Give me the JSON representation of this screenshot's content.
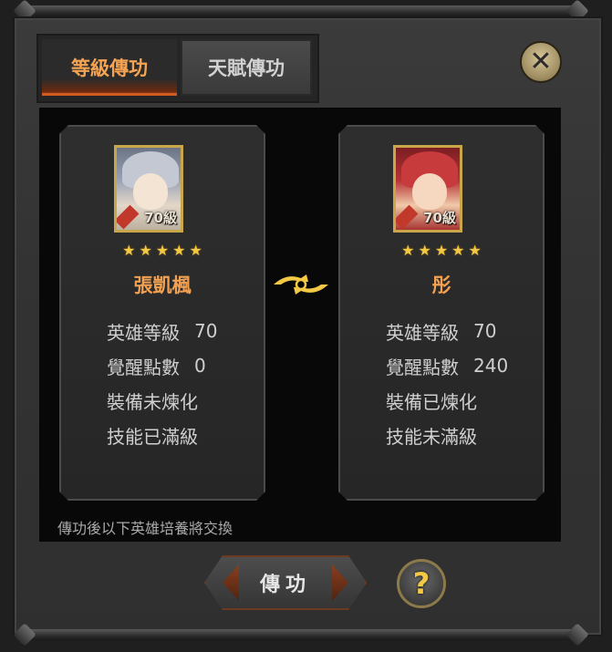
{
  "tabs": [
    {
      "label": "等級傳功",
      "active": true
    },
    {
      "label": "天賦傳功",
      "active": false
    }
  ],
  "close": {
    "icon": "close-icon",
    "glyph": "✕"
  },
  "heroes": {
    "source": {
      "name": "張凱楓",
      "level_badge": "70級",
      "stars": [
        "★",
        "★",
        "★",
        "★",
        "★"
      ],
      "stats": [
        {
          "label": "英雄等級",
          "value": "70"
        },
        {
          "label": "覺醒點數",
          "value": "0"
        },
        {
          "label": "裝備未煉化",
          "value": ""
        },
        {
          "label": "技能已滿級",
          "value": ""
        }
      ]
    },
    "target": {
      "name": "彤",
      "level_badge": "70級",
      "stars": [
        "★",
        "★",
        "★",
        "★",
        "★"
      ],
      "stats": [
        {
          "label": "英雄等級",
          "value": "70"
        },
        {
          "label": "覺醒點數",
          "value": "240"
        },
        {
          "label": "裝備已煉化",
          "value": ""
        },
        {
          "label": "技能未滿級",
          "value": ""
        }
      ]
    }
  },
  "swap_icon": "swap-arrows-icon",
  "footer_note": "傳功後以下英雄培養將交換",
  "transfer_button": "傳功",
  "help_button": "?",
  "colors": {
    "accent_orange": "#f2a152",
    "star_gold": "#f3c845",
    "frame_gold": "#c9a64a"
  }
}
